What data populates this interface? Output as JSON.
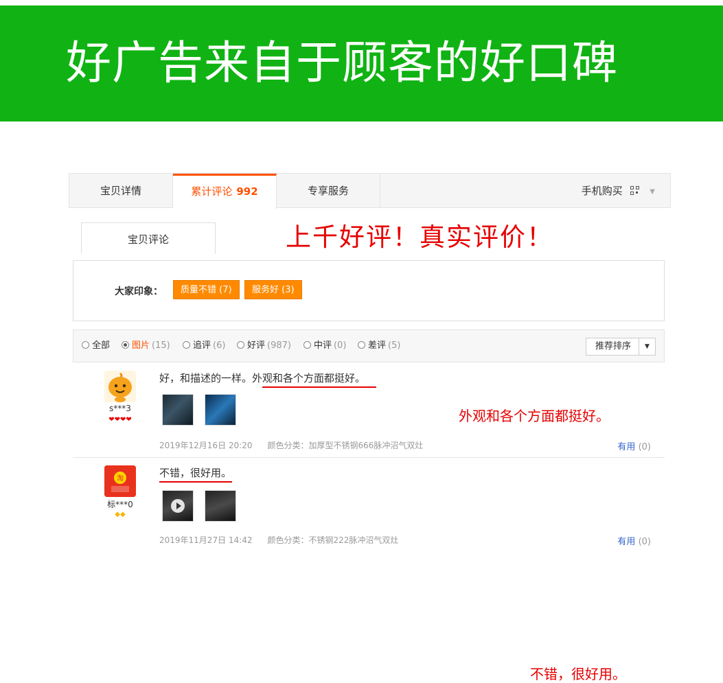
{
  "banner": {
    "title": "好广告来自于顾客的好口碑",
    "color": "#10b313"
  },
  "tabs": [
    {
      "label": "宝贝详情"
    },
    {
      "label": "累计评论",
      "count": "992"
    },
    {
      "label": "专享服务"
    }
  ],
  "mobile_buy": {
    "label": "手机购买"
  },
  "subtab": {
    "label": "宝贝评论"
  },
  "promo_text": "上千好评！真实评价！",
  "impressions": {
    "label": "大家印象：",
    "tags": [
      "质量不错 (7)",
      "服务好 (3)"
    ]
  },
  "filters": [
    {
      "label": "全部",
      "count": ""
    },
    {
      "label": "图片",
      "count": "(15)"
    },
    {
      "label": "追评",
      "count": "(6)"
    },
    {
      "label": "好评",
      "count": "(987)"
    },
    {
      "label": "中评",
      "count": "(0)"
    },
    {
      "label": "差评",
      "count": "(5)"
    }
  ],
  "sort": {
    "label": "推荐排序"
  },
  "reviews": [
    {
      "nick": "s***3",
      "badges": "❤❤❤❤",
      "text": "好，和描述的一样。外观和各个方面都挺好。",
      "highlight": "外观和各个方面都挺好。",
      "date": "2019年12月16日 20:20",
      "sku": "颜色分类：加厚型不锈钢666脉冲沼气双灶",
      "useful_label": "有用",
      "useful_count": "(0)"
    },
    {
      "nick": "标***0",
      "badges": "◆◆",
      "text": "不错，很好用。",
      "highlight": "不错，很好用。",
      "date": "2019年11月27日 14:42",
      "sku": "颜色分类：不锈钢222脉冲沼气双灶",
      "useful_label": "有用",
      "useful_count": "(0)"
    }
  ]
}
